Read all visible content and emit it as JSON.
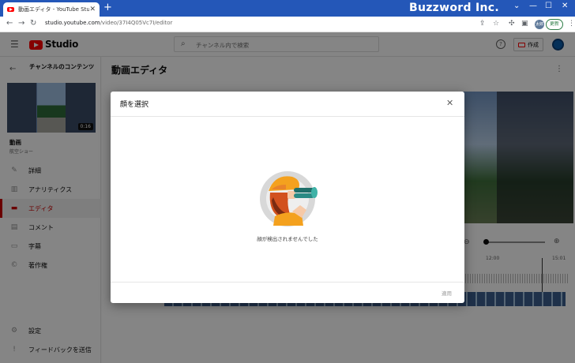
{
  "browser": {
    "tab_title": "動画エディタ - YouTube Studio",
    "url_host": "studio.youtube.com",
    "url_path": "/video/37I4Q05Vc7I/editor",
    "profile": "太郎",
    "update_label": "更新",
    "brand": "Buzzword Inc."
  },
  "header": {
    "logo_text": "Studio",
    "search_placeholder": "チャンネル内で検索",
    "create_label": "作成"
  },
  "sidebar": {
    "channel_title": "チャンネルのコンテンツ",
    "duration": "0:16",
    "video_label": "動画",
    "video_sub": "航空ショー",
    "items": [
      {
        "label": "詳細",
        "icon": "pencil-icon"
      },
      {
        "label": "アナリティクス",
        "icon": "analytics-icon"
      },
      {
        "label": "エディタ",
        "icon": "editor-icon",
        "active": true
      },
      {
        "label": "コメント",
        "icon": "comment-icon"
      },
      {
        "label": "字幕",
        "icon": "subtitles-icon"
      },
      {
        "label": "著作権",
        "icon": "copyright-icon"
      }
    ],
    "settings_label": "設定",
    "feedback_label": "フィードバックを送信"
  },
  "main": {
    "title": "動画エディタ",
    "timestamp_1": "12:00",
    "timestamp_2": "15:01"
  },
  "dialog": {
    "title": "顔を選択",
    "empty_message": "顔が検出されませんでした",
    "apply_label": "適用"
  },
  "colors": {
    "youtube_red": "#ff0000",
    "accent_active": "#cc0000",
    "chrome_blue": "#2457b8"
  }
}
